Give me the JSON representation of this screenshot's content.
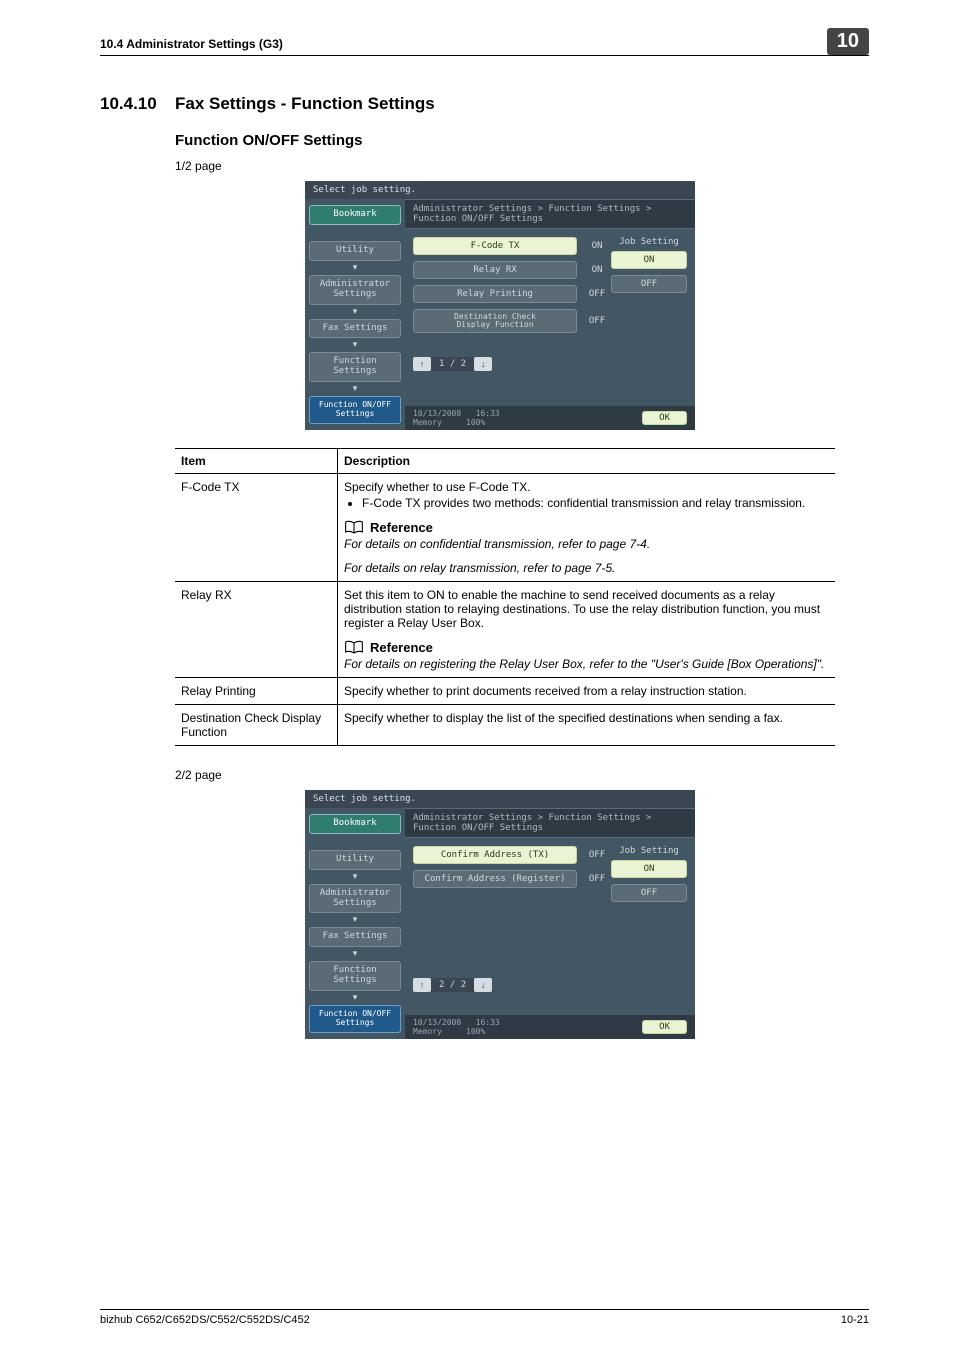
{
  "header": {
    "section_left": "10.4   Administrator Settings (G3)",
    "chip": "10"
  },
  "section": {
    "num": "10.4.10",
    "title": "Fax Settings - Function Settings"
  },
  "sub": {
    "title": "Function ON/OFF Settings"
  },
  "page_note_1": "1/2 page",
  "page_note_2": "2/2 page",
  "screenshot_common": {
    "topbar": "Select job setting.",
    "crumbs": "Administrator Settings > Function Settings > Function ON/OFF Settings",
    "nav": {
      "bookmark": "Bookmark",
      "utility": "Utility",
      "admin": "Administrator\nSettings",
      "fax": "Fax Settings",
      "func": "Function\nSettings",
      "onoff": "Function ON/OFF\nSettings"
    },
    "right": {
      "label": "Job Setting",
      "on": "ON",
      "off": "OFF"
    },
    "footer": {
      "date": "10/13/2008",
      "time": "16:33",
      "mem_lbl": "Memory",
      "mem_val": "100%",
      "ok": "OK"
    }
  },
  "shot1": {
    "rows": [
      {
        "label": "F-Code TX",
        "val": "ON",
        "selected": true
      },
      {
        "label": "Relay RX",
        "val": "ON",
        "selected": false
      },
      {
        "label": "Relay Printing",
        "val": "OFF",
        "selected": false
      },
      {
        "label": "Destination Check\nDisplay Function",
        "val": "OFF",
        "selected": false
      }
    ],
    "pager": {
      "cur": "1",
      "tot": "2"
    }
  },
  "shot2": {
    "rows": [
      {
        "label": "Confirm Address (TX)",
        "val": "OFF",
        "selected": true
      },
      {
        "label": "Confirm Address (Register)",
        "val": "OFF",
        "selected": false
      }
    ],
    "pager": {
      "cur": "2",
      "tot": "2"
    }
  },
  "table": {
    "head": {
      "c1": "Item",
      "c2": "Description"
    },
    "rows": [
      {
        "item": "F-Code TX",
        "body": "Specify whether to use F-Code TX.",
        "bullet": "F-Code TX provides two methods: confidential transmission and relay transmission.",
        "ref_lbl": "Reference",
        "ref1": "For details on confidential transmission, refer to page 7-4.",
        "ref2": "For details on relay transmission, refer to page 7-5."
      },
      {
        "item": "Relay RX",
        "body": "Set this item to ON to enable the machine to send received documents as a relay distribution station to relaying destinations. To use the relay distribution function, you must register a Relay User Box.",
        "ref_lbl": "Reference",
        "ref1": "For details on registering the Relay User Box, refer to the \"User's Guide [Box Operations]\"."
      },
      {
        "item": "Relay Printing",
        "body": "Specify whether to print documents received from a relay instruction station."
      },
      {
        "item": "Destination Check Display Function",
        "body": "Specify whether to display the list of the specified destinations when sending a fax."
      }
    ]
  },
  "footer": {
    "left": "bizhub C652/C652DS/C552/C552DS/C452",
    "right": "10-21"
  }
}
